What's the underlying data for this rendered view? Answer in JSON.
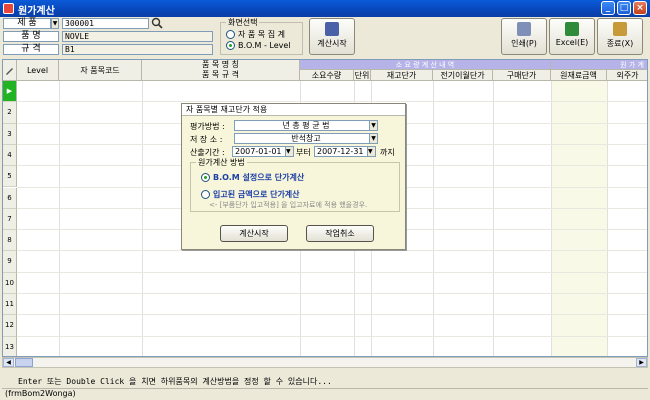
{
  "window": {
    "title": "원가계산",
    "minimize": "_",
    "maximize": "□",
    "close": "×"
  },
  "form": {
    "item_label": "제  품",
    "item_value": "300001",
    "name_label": "품  명",
    "name_value": "NOVLE",
    "spec_label": "규  격",
    "spec_value": "B1"
  },
  "screen_select": {
    "legend": "화면선택",
    "options": [
      {
        "label": "자 품 목 집 계",
        "selected": false
      },
      {
        "label": "B.O.M - Level",
        "selected": true
      }
    ]
  },
  "toolbar": {
    "calc": "계산시작",
    "print": "인쇄(P)",
    "excel": "Excel(E)",
    "exit": "종료(X)",
    "colors": {
      "print": "#7e8fb8",
      "excel": "#2f8a3a",
      "exit": "#c79a3a",
      "calc": "#4a61a8"
    }
  },
  "grid": {
    "headers": {
      "level": "Level",
      "code": "자 품목코드",
      "name_spec_1": "품  목  명  칭",
      "name_spec_2": "품  목  규  격",
      "group_consume": "소 요 량  계 산  내 역",
      "qty": "소요수량",
      "unit": "단위",
      "stock_price": "재고단가",
      "prev_price": "전기이월단가",
      "buy_price": "구매단가",
      "group_cost": "원  가  계",
      "material": "원재료금액",
      "outsource": "외주가"
    },
    "rows": [
      "1",
      "2",
      "3",
      "4",
      "5",
      "6",
      "7",
      "8",
      "9",
      "10",
      "11",
      "12",
      "13"
    ],
    "current_marker": "▶"
  },
  "dialog": {
    "title": "자 품목별 재고단가 적용",
    "method_label": "평가방법 :",
    "method_value": "년 총 평 균 법",
    "store_label": "저 장 소 :",
    "store_value": "반석창고",
    "period_label": "산출기간 :",
    "from_date": "2007-01-01",
    "from_word": "부터",
    "to_date": "2007-12-31",
    "to_word": "까지",
    "group_label": "원가계산 방법",
    "options": [
      {
        "label": "B.O.M 설정으로 단가계산",
        "selected": true
      },
      {
        "label": "입고된 금액으로 단가계산",
        "selected": false
      }
    ],
    "hint": "<- [부품단가 입고적용] 을 입고자료에 적용 했을경우.",
    "start_button": "계산시작",
    "cancel_button": "작업취소"
  },
  "status": {
    "message": "Enter 또는 Double Click 을 치면 하위품목의 계산방법을 정정 할 수 있습니다...",
    "form_id": "(frmBom2Wonga)"
  }
}
